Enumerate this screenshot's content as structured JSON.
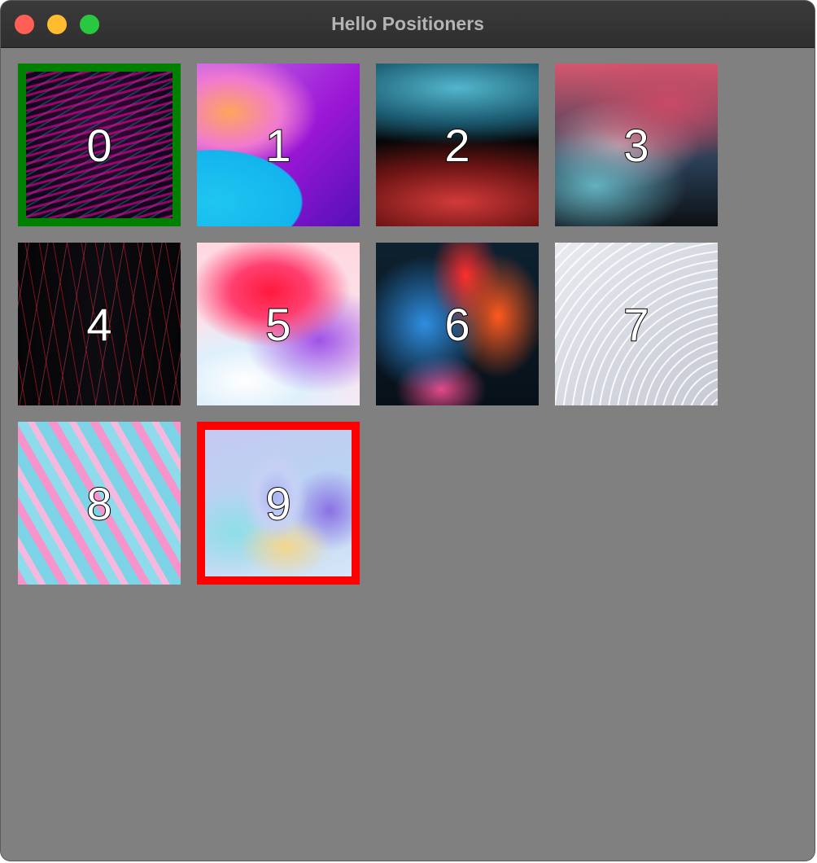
{
  "window": {
    "title": "Hello Positioners"
  },
  "traffic_lights": [
    "close",
    "minimize",
    "maximize"
  ],
  "grid": {
    "items": [
      {
        "label": "0",
        "highlight": "green"
      },
      {
        "label": "1",
        "highlight": "none"
      },
      {
        "label": "2",
        "highlight": "none"
      },
      {
        "label": "3",
        "highlight": "none"
      },
      {
        "label": "4",
        "highlight": "none"
      },
      {
        "label": "5",
        "highlight": "none"
      },
      {
        "label": "6",
        "highlight": "none"
      },
      {
        "label": "7",
        "highlight": "none"
      },
      {
        "label": "8",
        "highlight": "none"
      },
      {
        "label": "9",
        "highlight": "red"
      }
    ]
  },
  "colors": {
    "background": "#808080",
    "titlebar": "#333333",
    "highlight_green": "#008000",
    "highlight_red": "#ff0000"
  }
}
